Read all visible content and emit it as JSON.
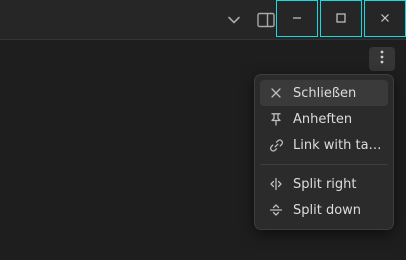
{
  "titlebar": {
    "icons": [
      "chevron-down-icon",
      "sidebar-toggle-icon"
    ],
    "window_controls": [
      "minimize-icon",
      "maximize-icon",
      "close-icon"
    ]
  },
  "more_button": {
    "icon": "more-vertical-icon"
  },
  "menu": {
    "items": [
      {
        "label": "Schließen",
        "icon": "close-icon"
      },
      {
        "label": "Anheften",
        "icon": "pin-icon"
      },
      {
        "label": "Link with tab...",
        "icon": "link-icon"
      },
      {
        "label": "Split right",
        "icon": "split-vertical-icon"
      },
      {
        "label": "Split down",
        "icon": "split-horizontal-icon"
      }
    ]
  },
  "colors": {
    "background": "#1e1e1e",
    "titlebar": "#262626",
    "menu_bg": "#2b2b2b",
    "menu_hover": "#3a3a3a",
    "window_control_outline": "#18d8e0",
    "text": "#dcddde"
  }
}
